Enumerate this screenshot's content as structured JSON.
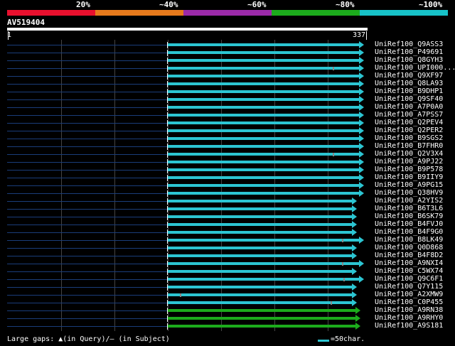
{
  "scale": {
    "labels": [
      "20%",
      "~40%",
      "~60%",
      "~80%",
      "~100%"
    ],
    "colors": [
      "#e8102e",
      "#e67a1c",
      "#9b2aa8",
      "#1cab1c",
      "#17c2c8"
    ]
  },
  "query": {
    "name": "AV519404",
    "start": "1",
    "end": "337"
  },
  "hits": [
    {
      "name": "UniRef100_Q9ASS3",
      "color": "#2cc5d2",
      "end": 0.99,
      "gap": null
    },
    {
      "name": "UniRef100_P49691",
      "color": "#2cc5d2",
      "end": 0.99,
      "gap": null
    },
    {
      "name": "UniRef100_Q8GYH3",
      "color": "#2cc5d2",
      "end": 0.99,
      "gap": null
    },
    {
      "name": "UniRef100_UPI000...",
      "color": "#2cc5d2",
      "end": 0.99,
      "gap": 0.905
    },
    {
      "name": "UniRef100_Q9XF97",
      "color": "#2cc5d2",
      "end": 0.99,
      "gap": null
    },
    {
      "name": "UniRef100_Q8LA93",
      "color": "#2cc5d2",
      "end": 0.99,
      "gap": null
    },
    {
      "name": "UniRef100_B9DHP1",
      "color": "#2cc5d2",
      "end": 0.99,
      "gap": null
    },
    {
      "name": "UniRef100_Q9SF40",
      "color": "#2cc5d2",
      "end": 0.99,
      "gap": null
    },
    {
      "name": "UniRef100_A7P0A0",
      "color": "#2cc5d2",
      "end": 0.99,
      "gap": null
    },
    {
      "name": "UniRef100_A7PSS7",
      "color": "#2cc5d2",
      "end": 0.99,
      "gap": null
    },
    {
      "name": "UniRef100_Q2PEV4",
      "color": "#2cc5d2",
      "end": 0.99,
      "gap": null
    },
    {
      "name": "UniRef100_Q2PER2",
      "color": "#2cc5d2",
      "end": 0.99,
      "gap": null
    },
    {
      "name": "UniRef100_B9SGS2",
      "color": "#2cc5d2",
      "end": 0.99,
      "gap": null
    },
    {
      "name": "UniRef100_B7FHR0",
      "color": "#2cc5d2",
      "end": 0.99,
      "gap": null
    },
    {
      "name": "UniRef100_Q2V3X4",
      "color": "#2cc5d2",
      "end": 0.99,
      "gap": 0.905
    },
    {
      "name": "UniRef100_A9PJ22",
      "color": "#2cc5d2",
      "end": 0.99,
      "gap": null
    },
    {
      "name": "UniRef100_B9P578",
      "color": "#2cc5d2",
      "end": 0.99,
      "gap": null
    },
    {
      "name": "UniRef100_B9IIY9",
      "color": "#2cc5d2",
      "end": 0.99,
      "gap": null
    },
    {
      "name": "UniRef100_A9PG15",
      "color": "#2cc5d2",
      "end": 0.99,
      "gap": null
    },
    {
      "name": "UniRef100_Q38HV9",
      "color": "#2cc5d2",
      "end": 0.99,
      "gap": null
    },
    {
      "name": "UniRef100_A2YIS2",
      "color": "#2cc5d2",
      "end": 0.97,
      "gap": null
    },
    {
      "name": "UniRef100_B6T3L6",
      "color": "#2cc5d2",
      "end": 0.97,
      "gap": null
    },
    {
      "name": "UniRef100_B6SK79",
      "color": "#2cc5d2",
      "end": 0.97,
      "gap": null
    },
    {
      "name": "UniRef100_B4FVJ0",
      "color": "#2cc5d2",
      "end": 0.97,
      "gap": null
    },
    {
      "name": "UniRef100_B4F9G0",
      "color": "#2cc5d2",
      "end": 0.97,
      "gap": null
    },
    {
      "name": "UniRef100_B8LK49",
      "color": "#2cc5d2",
      "end": 0.99,
      "gap": 0.93
    },
    {
      "name": "UniRef100_Q0D868",
      "color": "#2cc5d2",
      "end": 0.97,
      "gap": null
    },
    {
      "name": "UniRef100_B4F8D2",
      "color": "#2cc5d2",
      "end": 0.97,
      "gap": null
    },
    {
      "name": "UniRef100_A9NXI4",
      "color": "#2cc5d2",
      "end": 0.99,
      "gap": 0.93
    },
    {
      "name": "UniRef100_C5WX74",
      "color": "#2cc5d2",
      "end": 0.97,
      "gap": null
    },
    {
      "name": "UniRef100_Q9C6F1",
      "color": "#2cc5d2",
      "end": 0.99,
      "gap": 0.935
    },
    {
      "name": "UniRef100_Q7Y115",
      "color": "#2cc5d2",
      "end": 0.97,
      "gap": null
    },
    {
      "name": "UniRef100_A2XMW9",
      "color": "#2cc5d2",
      "end": 0.97,
      "gap": 0.48
    },
    {
      "name": "UniRef100_C0P455",
      "color": "#2cc5d2",
      "end": 0.97,
      "gap": 0.9
    },
    {
      "name": "UniRef100_A9RN38",
      "color": "#1cab1c",
      "end": 0.98,
      "gap": null
    },
    {
      "name": "UniRef100_A9RHY0",
      "color": "#1cab1c",
      "end": 0.98,
      "gap": null
    },
    {
      "name": "UniRef100_A9S181",
      "color": "#1cab1c",
      "end": 0.98,
      "gap": null
    }
  ],
  "legend": {
    "text": "Large gaps: ▲(in Query)/– (in Subject)",
    "scale_text": "=50char."
  }
}
